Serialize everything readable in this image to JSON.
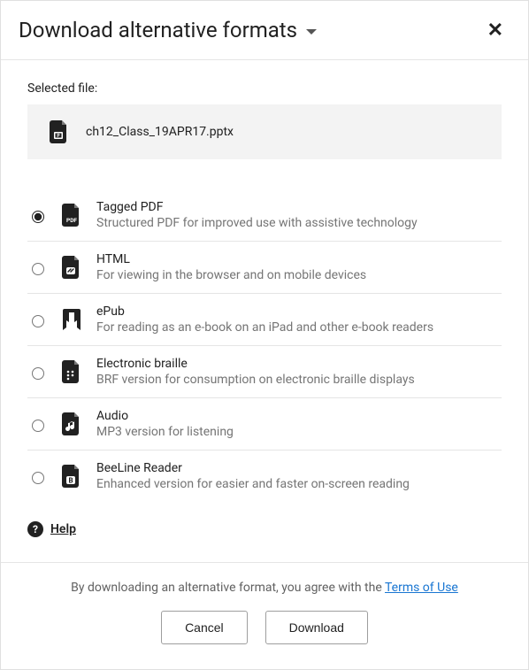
{
  "header": {
    "title": "Download alternative formats"
  },
  "selected": {
    "label": "Selected file:",
    "filename": "ch12_Class_19APR17.pptx"
  },
  "options": [
    {
      "id": "tagged-pdf",
      "title": "Tagged PDF",
      "desc": "Structured PDF for improved use with assistive technology",
      "selected": true
    },
    {
      "id": "html",
      "title": "HTML",
      "desc": "For viewing in the browser and on mobile devices",
      "selected": false
    },
    {
      "id": "epub",
      "title": "ePub",
      "desc": "For reading as an e-book on an iPad and other e-book readers",
      "selected": false
    },
    {
      "id": "braille",
      "title": "Electronic braille",
      "desc": "BRF version for consumption on electronic braille displays",
      "selected": false
    },
    {
      "id": "audio",
      "title": "Audio",
      "desc": "MP3 version for listening",
      "selected": false
    },
    {
      "id": "beeline",
      "title": "BeeLine Reader",
      "desc": "Enhanced version for easier and faster on-screen reading",
      "selected": false
    }
  ],
  "help": {
    "label": "Help"
  },
  "footer": {
    "agree_prefix": "By downloading an alternative format, you agree with the ",
    "terms_label": "Terms of Use",
    "cancel": "Cancel",
    "download": "Download"
  }
}
